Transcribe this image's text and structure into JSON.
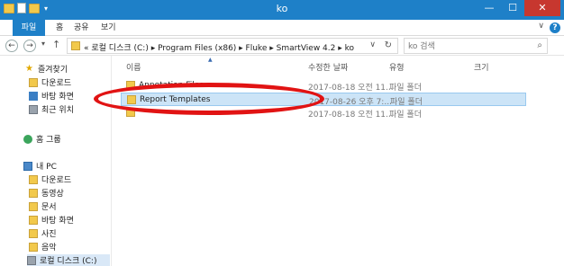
{
  "window": {
    "title": "ko"
  },
  "ribbon": {
    "tabs": [
      "파일",
      "홈",
      "공유",
      "보기"
    ]
  },
  "address": {
    "crumbs": [
      "로컬 디스크 (C:)",
      "Program Files (x86)",
      "Fluke",
      "SmartView 4.2",
      "ko"
    ],
    "breadcrumb_text": "« 로컬 디스크 (C:) ▸ Program Files (x86) ▸ Fluke ▸ SmartView 4.2 ▸ ko",
    "search_placeholder": "ko 검색"
  },
  "sidebar": {
    "favorites": {
      "label": "즐겨찾기",
      "items": [
        "다운로드",
        "바탕 화면",
        "최근 위치"
      ]
    },
    "homegroup": {
      "label": "홈 그룹"
    },
    "pc": {
      "label": "내 PC",
      "items": [
        "다운로드",
        "동영상",
        "문서",
        "바탕 화면",
        "사진",
        "음악",
        "로컬 디스크 (C:)"
      ]
    }
  },
  "columns": {
    "name": "이름",
    "modified": "수정한 날짜",
    "type": "유형",
    "size": "크기"
  },
  "files": [
    {
      "name": "Annotation Files",
      "modified": "2017-08-18 오전 11...",
      "type": "파일 폴더"
    },
    {
      "name": "Report Templates",
      "modified": "2017-08-26 오후 7:...",
      "type": "파일 폴더",
      "selected": true
    },
    {
      "name": "",
      "modified": "2017-08-18 오전 11...",
      "type": "파일 폴더"
    }
  ],
  "annotation": {
    "color": "#e11313"
  }
}
